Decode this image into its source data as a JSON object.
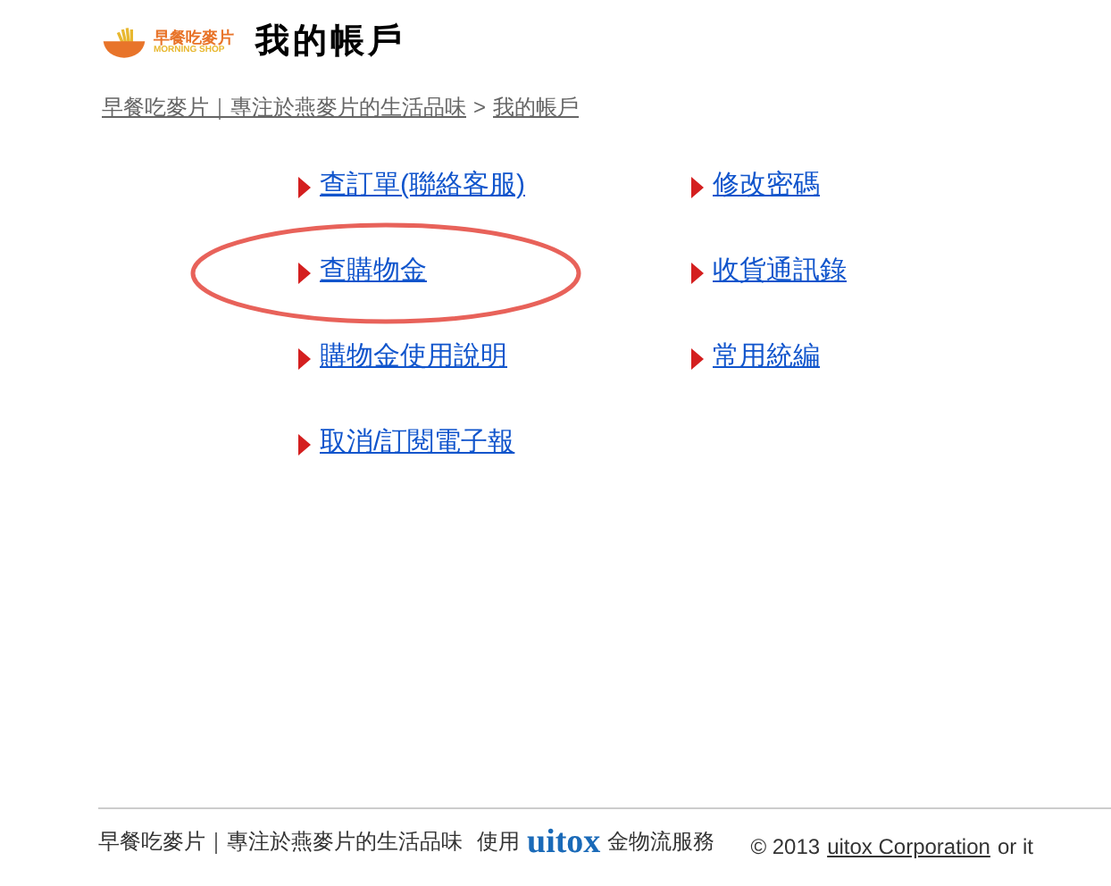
{
  "logo": {
    "name": "早餐吃麥片",
    "tagline": "MORNING SHOP"
  },
  "title": "我的帳戶",
  "breadcrumb": [
    {
      "label": "早餐吃麥片｜專注於燕麥片的生活品味"
    },
    {
      "label": "我的帳戶"
    }
  ],
  "breadcrumb_separator": ">",
  "links": [
    {
      "label": "查訂單(聯絡客服)",
      "circled": false
    },
    {
      "label": "修改密碼",
      "circled": false
    },
    {
      "label": "查購物金",
      "circled": true
    },
    {
      "label": "收貨通訊錄",
      "circled": false
    },
    {
      "label": "購物金使用說明",
      "circled": false
    },
    {
      "label": "常用統編",
      "circled": false
    },
    {
      "label": "取消/訂閱電子報",
      "circled": false
    }
  ],
  "footer": {
    "shop": "早餐吃麥片｜專注於燕麥片的生活品味",
    "using": "使用",
    "brand": "uitox",
    "service": "金物流服務",
    "copyright": "© 2013",
    "company_link": "uitox Corporation",
    "rest": "or it"
  }
}
